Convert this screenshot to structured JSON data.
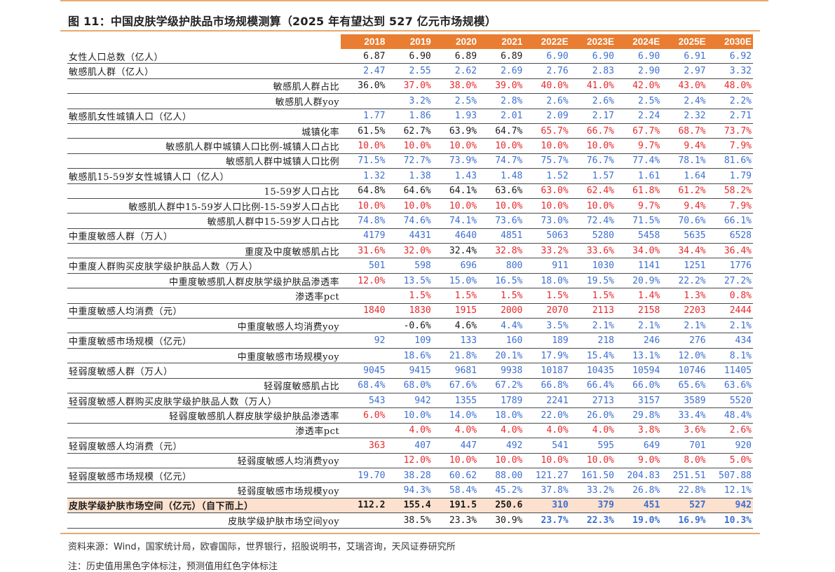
{
  "title": "图 11：中国皮肤学级护肤品市场规模测算（2025 年有望达到 527 亿元市场规模）",
  "header": [
    "",
    "2018",
    "2019",
    "2020",
    "2021",
    "2022E",
    "2023E",
    "2024E",
    "2025E",
    "2030E"
  ],
  "rows": [
    {
      "label": "女性人口总数（亿人）",
      "indent": 0,
      "cells": [
        [
          "6.87",
          "k"
        ],
        [
          "6.90",
          "k"
        ],
        [
          "6.89",
          "k"
        ],
        [
          "6.89",
          "k"
        ],
        [
          "6.90",
          "b"
        ],
        [
          "6.90",
          "b"
        ],
        [
          "6.90",
          "b"
        ],
        [
          "6.91",
          "b"
        ],
        [
          "6.92",
          "b"
        ]
      ]
    },
    {
      "label": "敏感肌人群（亿人）",
      "indent": 0,
      "cells": [
        [
          "2.47",
          "b"
        ],
        [
          "2.55",
          "b"
        ],
        [
          "2.62",
          "b"
        ],
        [
          "2.69",
          "b"
        ],
        [
          "2.76",
          "b"
        ],
        [
          "2.83",
          "b"
        ],
        [
          "2.90",
          "b"
        ],
        [
          "2.97",
          "b"
        ],
        [
          "3.32",
          "b"
        ]
      ]
    },
    {
      "label": "敏感肌人群占比",
      "indent": 1,
      "cells": [
        [
          "36.0%",
          "k"
        ],
        [
          "37.0%",
          "r"
        ],
        [
          "38.0%",
          "r"
        ],
        [
          "39.0%",
          "r"
        ],
        [
          "40.0%",
          "r"
        ],
        [
          "41.0%",
          "r"
        ],
        [
          "42.0%",
          "r"
        ],
        [
          "43.0%",
          "r"
        ],
        [
          "48.0%",
          "r"
        ]
      ]
    },
    {
      "label": "敏感肌人群yoy",
      "indent": 1,
      "cells": [
        [
          "",
          "k"
        ],
        [
          "3.2%",
          "b"
        ],
        [
          "2.5%",
          "b"
        ],
        [
          "2.8%",
          "b"
        ],
        [
          "2.6%",
          "b"
        ],
        [
          "2.6%",
          "b"
        ],
        [
          "2.5%",
          "b"
        ],
        [
          "2.4%",
          "b"
        ],
        [
          "2.2%",
          "b"
        ]
      ]
    },
    {
      "label": "敏感肌女性城镇人口（亿人）",
      "indent": 0,
      "cells": [
        [
          "1.77",
          "b"
        ],
        [
          "1.86",
          "b"
        ],
        [
          "1.93",
          "b"
        ],
        [
          "2.01",
          "b"
        ],
        [
          "2.09",
          "b"
        ],
        [
          "2.17",
          "b"
        ],
        [
          "2.24",
          "b"
        ],
        [
          "2.32",
          "b"
        ],
        [
          "2.71",
          "b"
        ]
      ]
    },
    {
      "label": "城镇化率",
      "indent": 1,
      "cells": [
        [
          "61.5%",
          "k"
        ],
        [
          "62.7%",
          "k"
        ],
        [
          "63.9%",
          "k"
        ],
        [
          "64.7%",
          "k"
        ],
        [
          "65.7%",
          "r"
        ],
        [
          "66.7%",
          "r"
        ],
        [
          "67.7%",
          "r"
        ],
        [
          "68.7%",
          "r"
        ],
        [
          "73.7%",
          "r"
        ]
      ]
    },
    {
      "label": "敏感肌人群中城镇人口比例-城镇人口占比",
      "indent": 1,
      "cells": [
        [
          "10.0%",
          "r"
        ],
        [
          "10.0%",
          "r"
        ],
        [
          "10.0%",
          "r"
        ],
        [
          "10.0%",
          "r"
        ],
        [
          "10.0%",
          "r"
        ],
        [
          "10.0%",
          "r"
        ],
        [
          "9.7%",
          "r"
        ],
        [
          "9.4%",
          "r"
        ],
        [
          "7.9%",
          "r"
        ]
      ]
    },
    {
      "label": "敏感肌人群中城镇人口比例",
      "indent": 1,
      "cells": [
        [
          "71.5%",
          "b"
        ],
        [
          "72.7%",
          "b"
        ],
        [
          "73.9%",
          "b"
        ],
        [
          "74.7%",
          "b"
        ],
        [
          "75.7%",
          "b"
        ],
        [
          "76.7%",
          "b"
        ],
        [
          "77.4%",
          "b"
        ],
        [
          "78.1%",
          "b"
        ],
        [
          "81.6%",
          "b"
        ]
      ]
    },
    {
      "label": "敏感肌15-59岁女性城镇人口（亿人）",
      "indent": 0,
      "cells": [
        [
          "1.32",
          "b"
        ],
        [
          "1.38",
          "b"
        ],
        [
          "1.43",
          "b"
        ],
        [
          "1.48",
          "b"
        ],
        [
          "1.52",
          "b"
        ],
        [
          "1.57",
          "b"
        ],
        [
          "1.61",
          "b"
        ],
        [
          "1.64",
          "b"
        ],
        [
          "1.79",
          "b"
        ]
      ]
    },
    {
      "label": "15-59岁人口占比",
      "indent": 1,
      "cells": [
        [
          "64.8%",
          "k"
        ],
        [
          "64.6%",
          "k"
        ],
        [
          "64.1%",
          "k"
        ],
        [
          "63.6%",
          "k"
        ],
        [
          "63.0%",
          "r"
        ],
        [
          "62.4%",
          "r"
        ],
        [
          "61.8%",
          "r"
        ],
        [
          "61.2%",
          "r"
        ],
        [
          "58.2%",
          "r"
        ]
      ]
    },
    {
      "label": "敏感肌人群中15-59岁人口比例-15-59岁人口占比",
      "indent": 1,
      "cells": [
        [
          "10.0%",
          "r"
        ],
        [
          "10.0%",
          "r"
        ],
        [
          "10.0%",
          "r"
        ],
        [
          "10.0%",
          "r"
        ],
        [
          "10.0%",
          "r"
        ],
        [
          "10.0%",
          "r"
        ],
        [
          "9.7%",
          "r"
        ],
        [
          "9.4%",
          "r"
        ],
        [
          "7.9%",
          "r"
        ]
      ]
    },
    {
      "label": "敏感肌人群中15-59岁人口占比",
      "indent": 1,
      "cells": [
        [
          "74.8%",
          "b"
        ],
        [
          "74.6%",
          "b"
        ],
        [
          "74.1%",
          "b"
        ],
        [
          "73.6%",
          "b"
        ],
        [
          "73.0%",
          "b"
        ],
        [
          "72.4%",
          "b"
        ],
        [
          "71.5%",
          "b"
        ],
        [
          "70.6%",
          "b"
        ],
        [
          "66.1%",
          "b"
        ]
      ]
    },
    {
      "label": "中重度敏感人群（万人）",
      "indent": 0,
      "cells": [
        [
          "4179",
          "b"
        ],
        [
          "4431",
          "b"
        ],
        [
          "4640",
          "b"
        ],
        [
          "4851",
          "b"
        ],
        [
          "5063",
          "b"
        ],
        [
          "5280",
          "b"
        ],
        [
          "5458",
          "b"
        ],
        [
          "5635",
          "b"
        ],
        [
          "6528",
          "b"
        ]
      ]
    },
    {
      "label": "重度及中度敏感肌占比",
      "indent": 1,
      "cells": [
        [
          "31.6%",
          "r"
        ],
        [
          "32.0%",
          "r"
        ],
        [
          "32.4%",
          "k"
        ],
        [
          "32.8%",
          "r"
        ],
        [
          "33.2%",
          "r"
        ],
        [
          "33.6%",
          "r"
        ],
        [
          "34.0%",
          "r"
        ],
        [
          "34.4%",
          "r"
        ],
        [
          "36.4%",
          "r"
        ]
      ]
    },
    {
      "label": "中重度人群购买皮肤学级护肤品人数（万人）",
      "indent": 0,
      "cells": [
        [
          "501",
          "b"
        ],
        [
          "598",
          "b"
        ],
        [
          "696",
          "b"
        ],
        [
          "800",
          "b"
        ],
        [
          "911",
          "b"
        ],
        [
          "1030",
          "b"
        ],
        [
          "1141",
          "b"
        ],
        [
          "1251",
          "b"
        ],
        [
          "1776",
          "b"
        ]
      ]
    },
    {
      "label": "中重度敏感肌人群皮肤学级护肤品渗透率",
      "indent": 1,
      "cells": [
        [
          "12.0%",
          "r"
        ],
        [
          "13.5%",
          "b"
        ],
        [
          "15.0%",
          "b"
        ],
        [
          "16.5%",
          "b"
        ],
        [
          "18.0%",
          "b"
        ],
        [
          "19.5%",
          "b"
        ],
        [
          "20.9%",
          "b"
        ],
        [
          "22.2%",
          "b"
        ],
        [
          "27.2%",
          "b"
        ]
      ]
    },
    {
      "label": "渗透率pct",
      "indent": 1,
      "cells": [
        [
          "",
          "k"
        ],
        [
          "1.5%",
          "r"
        ],
        [
          "1.5%",
          "r"
        ],
        [
          "1.5%",
          "r"
        ],
        [
          "1.5%",
          "r"
        ],
        [
          "1.5%",
          "r"
        ],
        [
          "1.4%",
          "r"
        ],
        [
          "1.3%",
          "r"
        ],
        [
          "0.8%",
          "r"
        ]
      ]
    },
    {
      "label": "中重度敏感人均消费（元）",
      "indent": 0,
      "cells": [
        [
          "1840",
          "r"
        ],
        [
          "1830",
          "r"
        ],
        [
          "1915",
          "r"
        ],
        [
          "2000",
          "r"
        ],
        [
          "2070",
          "r"
        ],
        [
          "2113",
          "r"
        ],
        [
          "2158",
          "r"
        ],
        [
          "2203",
          "r"
        ],
        [
          "2444",
          "r"
        ]
      ]
    },
    {
      "label": "中重度敏感人均消费yoy",
      "indent": 1,
      "cells": [
        [
          "",
          "k"
        ],
        [
          "-0.6%",
          "k"
        ],
        [
          "4.6%",
          "k"
        ],
        [
          "4.4%",
          "b"
        ],
        [
          "3.5%",
          "b"
        ],
        [
          "2.1%",
          "b"
        ],
        [
          "2.1%",
          "b"
        ],
        [
          "2.1%",
          "b"
        ],
        [
          "2.1%",
          "b"
        ]
      ]
    },
    {
      "label": "中重度敏感市场规模（亿元）",
      "indent": 0,
      "cells": [
        [
          "92",
          "b"
        ],
        [
          "109",
          "b"
        ],
        [
          "133",
          "b"
        ],
        [
          "160",
          "b"
        ],
        [
          "189",
          "b"
        ],
        [
          "218",
          "b"
        ],
        [
          "246",
          "b"
        ],
        [
          "276",
          "b"
        ],
        [
          "434",
          "b"
        ]
      ]
    },
    {
      "label": "中重度敏感市场规模yoy",
      "indent": 1,
      "cells": [
        [
          "",
          "k"
        ],
        [
          "18.6%",
          "b"
        ],
        [
          "21.8%",
          "b"
        ],
        [
          "20.1%",
          "b"
        ],
        [
          "17.9%",
          "b"
        ],
        [
          "15.4%",
          "b"
        ],
        [
          "13.1%",
          "b"
        ],
        [
          "12.0%",
          "b"
        ],
        [
          "8.1%",
          "b"
        ]
      ]
    },
    {
      "label": "轻弱度敏感人群（万人）",
      "indent": 0,
      "cells": [
        [
          "9045",
          "b"
        ],
        [
          "9415",
          "b"
        ],
        [
          "9681",
          "b"
        ],
        [
          "9938",
          "b"
        ],
        [
          "10187",
          "b"
        ],
        [
          "10435",
          "b"
        ],
        [
          "10594",
          "b"
        ],
        [
          "10746",
          "b"
        ],
        [
          "11405",
          "b"
        ]
      ]
    },
    {
      "label": "轻弱度敏感肌占比",
      "indent": 1,
      "cells": [
        [
          "68.4%",
          "b"
        ],
        [
          "68.0%",
          "b"
        ],
        [
          "67.6%",
          "b"
        ],
        [
          "67.2%",
          "b"
        ],
        [
          "66.8%",
          "b"
        ],
        [
          "66.4%",
          "b"
        ],
        [
          "66.0%",
          "b"
        ],
        [
          "65.6%",
          "b"
        ],
        [
          "63.6%",
          "b"
        ]
      ]
    },
    {
      "label": "轻弱度敏感人群购买皮肤学级护肤品人数（万人）",
      "indent": 0,
      "cells": [
        [
          "543",
          "b"
        ],
        [
          "942",
          "b"
        ],
        [
          "1355",
          "b"
        ],
        [
          "1789",
          "b"
        ],
        [
          "2241",
          "b"
        ],
        [
          "2713",
          "b"
        ],
        [
          "3157",
          "b"
        ],
        [
          "3589",
          "b"
        ],
        [
          "5520",
          "b"
        ]
      ]
    },
    {
      "label": "轻弱度敏感肌人群皮肤学级护肤品渗透率",
      "indent": 1,
      "cells": [
        [
          "6.0%",
          "r"
        ],
        [
          "10.0%",
          "b"
        ],
        [
          "14.0%",
          "b"
        ],
        [
          "18.0%",
          "b"
        ],
        [
          "22.0%",
          "b"
        ],
        [
          "26.0%",
          "b"
        ],
        [
          "29.8%",
          "b"
        ],
        [
          "33.4%",
          "b"
        ],
        [
          "48.4%",
          "b"
        ]
      ]
    },
    {
      "label": "渗透率pct",
      "indent": 1,
      "cells": [
        [
          "",
          "k"
        ],
        [
          "4.0%",
          "r"
        ],
        [
          "4.0%",
          "r"
        ],
        [
          "4.0%",
          "r"
        ],
        [
          "4.0%",
          "r"
        ],
        [
          "4.0%",
          "r"
        ],
        [
          "3.8%",
          "r"
        ],
        [
          "3.6%",
          "r"
        ],
        [
          "2.6%",
          "r"
        ]
      ]
    },
    {
      "label": "轻弱度敏感人均消费（元）",
      "indent": 0,
      "cells": [
        [
          "363",
          "r"
        ],
        [
          "407",
          "b"
        ],
        [
          "447",
          "b"
        ],
        [
          "492",
          "b"
        ],
        [
          "541",
          "b"
        ],
        [
          "595",
          "b"
        ],
        [
          "649",
          "b"
        ],
        [
          "701",
          "b"
        ],
        [
          "920",
          "b"
        ]
      ]
    },
    {
      "label": "轻弱度敏感人均消费yoy",
      "indent": 1,
      "cells": [
        [
          "",
          "k"
        ],
        [
          "12.0%",
          "r"
        ],
        [
          "10.0%",
          "r"
        ],
        [
          "10.0%",
          "r"
        ],
        [
          "10.0%",
          "r"
        ],
        [
          "10.0%",
          "r"
        ],
        [
          "9.0%",
          "r"
        ],
        [
          "8.0%",
          "r"
        ],
        [
          "5.0%",
          "r"
        ]
      ]
    },
    {
      "label": "轻弱度敏感市场规模（亿元）",
      "indent": 0,
      "cells": [
        [
          "19.70",
          "b"
        ],
        [
          "38.28",
          "b"
        ],
        [
          "60.62",
          "b"
        ],
        [
          "88.00",
          "b"
        ],
        [
          "121.27",
          "b"
        ],
        [
          "161.50",
          "b"
        ],
        [
          "204.83",
          "b"
        ],
        [
          "251.51",
          "b"
        ],
        [
          "507.88",
          "b"
        ]
      ]
    },
    {
      "label": "轻弱度敏感市场规模yoy",
      "indent": 1,
      "cells": [
        [
          "",
          "k"
        ],
        [
          "94.3%",
          "b"
        ],
        [
          "58.4%",
          "b"
        ],
        [
          "45.2%",
          "b"
        ],
        [
          "37.8%",
          "b"
        ],
        [
          "33.2%",
          "b"
        ],
        [
          "26.8%",
          "b"
        ],
        [
          "22.8%",
          "b"
        ],
        [
          "12.1%",
          "b"
        ]
      ]
    },
    {
      "label": "皮肤学级护肤市场空间（亿元）（自下而上）",
      "indent": 0,
      "highlight": true,
      "cells": [
        [
          "112.2",
          "k"
        ],
        [
          "155.4",
          "k"
        ],
        [
          "191.5",
          "k"
        ],
        [
          "250.6",
          "k"
        ],
        [
          "310",
          "b"
        ],
        [
          "379",
          "b"
        ],
        [
          "451",
          "b"
        ],
        [
          "527",
          "b"
        ],
        [
          "942",
          "b"
        ]
      ]
    },
    {
      "label": "皮肤学级护肤市场空间yoy",
      "indent": 1,
      "cells": [
        [
          "",
          "k"
        ],
        [
          "38.5%",
          "k"
        ],
        [
          "23.3%",
          "k"
        ],
        [
          "30.9%",
          "k"
        ],
        [
          "23.7%",
          "bb"
        ],
        [
          "22.3%",
          "bb"
        ],
        [
          "19.0%",
          "bb"
        ],
        [
          "16.9%",
          "bb"
        ],
        [
          "10.3%",
          "bb"
        ]
      ]
    }
  ],
  "source": "资料来源：Wind，国家统计局，欧睿国际，世界银行，招股说明书，艾瑞咨询，天风证券研究所",
  "note": "注：历史值用黑色字体标注，预测值用红色字体标注"
}
